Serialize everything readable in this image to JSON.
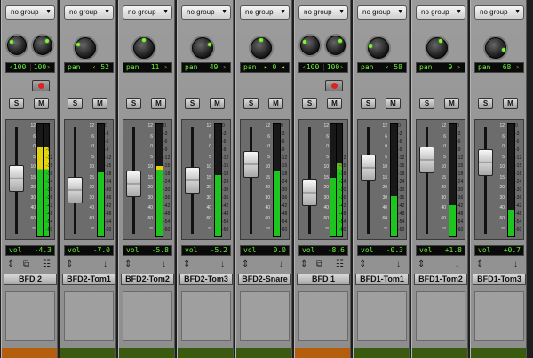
{
  "colors": {
    "lcd_text": "#6cf03a",
    "meter_green": "#1ec51e",
    "meter_yellow": "#e4d20a",
    "tag_orange": "#b35d0d",
    "tag_green": "#3a5a10",
    "record_red": "#dd2222"
  },
  "labels": {
    "group": "no group",
    "solo": "S",
    "mute": "M",
    "vol": "vol",
    "pan": "pan"
  },
  "scale_labels": [
    "12",
    "6",
    "0",
    "5",
    "10",
    "15",
    "20",
    "30",
    "40",
    "60",
    "∞"
  ],
  "db_labels": [
    "0",
    "-3",
    "-6",
    "-9",
    "-12",
    "-15",
    "-18",
    "-24",
    "-30",
    "-36",
    "-42",
    "-48",
    "-54",
    "-60"
  ],
  "strips": [
    {
      "name": "BFD 2",
      "stereo": true,
      "pan_left": "‹100",
      "pan_right": "100›",
      "vol": "-4.3",
      "fader": 0.52,
      "meter": [
        0.8,
        0.8
      ],
      "peak_yellow": true,
      "tag": "orange",
      "record": true
    },
    {
      "name": "BFD2-Tom1",
      "stereo": false,
      "pan_value": "‹ 52",
      "vol": "-7.0",
      "fader": 0.38,
      "meter": [
        0.57
      ],
      "peak_yellow": true,
      "tag": "green",
      "record": false
    },
    {
      "name": "BFD2-Tom2",
      "stereo": false,
      "pan_value": "11 ›",
      "vol": "-5.8",
      "fader": 0.46,
      "meter": [
        0.63
      ],
      "peak_yellow": true,
      "tag": "green",
      "record": false
    },
    {
      "name": "BFD2-Tom3",
      "stereo": false,
      "pan_value": "49 ›",
      "vol": "-5.2",
      "fader": 0.5,
      "meter": [
        0.55
      ],
      "peak_yellow": true,
      "tag": "green",
      "record": false
    },
    {
      "name": "BFD2-Snare",
      "stereo": false,
      "pan_value": "▸ 0 ◂",
      "vol": "0.0",
      "fader": 0.7,
      "meter": [
        0.58
      ],
      "peak_yellow": false,
      "tag": "green",
      "record": false
    },
    {
      "name": "BFD 1",
      "stereo": true,
      "pan_left": "‹100",
      "pan_right": "100›",
      "vol": "-8.6",
      "fader": 0.34,
      "meter": [
        0.52,
        0.65
      ],
      "peak_yellow": false,
      "tag": "orange",
      "record": true
    },
    {
      "name": "BFD1-Tom1",
      "stereo": false,
      "pan_value": "‹ 58",
      "vol": "-0.3",
      "fader": 0.66,
      "meter": [
        0.36
      ],
      "peak_yellow": false,
      "tag": "green",
      "record": false
    },
    {
      "name": "BFD1-Tom2",
      "stereo": false,
      "pan_value": "9 ›",
      "vol": "+1.8",
      "fader": 0.76,
      "meter": [
        0.28
      ],
      "peak_yellow": false,
      "tag": "green",
      "record": false
    },
    {
      "name": "BFD1-Tom3",
      "stereo": false,
      "pan_value": "68 ›",
      "vol": "+0.7",
      "fader": 0.72,
      "meter": [
        0.24
      ],
      "peak_yellow": false,
      "tag": "green",
      "record": false
    }
  ]
}
